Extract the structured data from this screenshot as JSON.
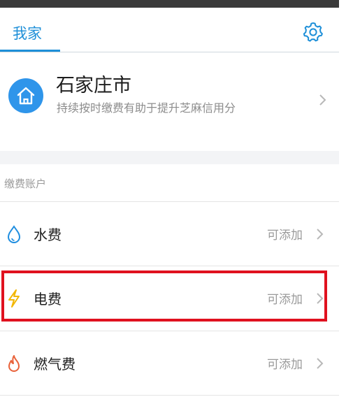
{
  "header": {
    "active_tab": "我家"
  },
  "home_card": {
    "city": "石家庄市",
    "subtitle": "持续按时缴费有助于提升芝麻信用分"
  },
  "accounts": {
    "section_label": "缴费账户",
    "items": [
      {
        "name": "水费",
        "status": "可添加",
        "icon": "water-drop-icon"
      },
      {
        "name": "电费",
        "status": "可添加",
        "icon": "lightning-icon"
      },
      {
        "name": "燃气费",
        "status": "可添加",
        "icon": "flame-icon"
      }
    ]
  },
  "colors": {
    "accent": "#1e8fd8",
    "highlight": "#e0111f",
    "water": "#1f8ee0",
    "electric": "#f2b705",
    "gas": "#e9623a"
  }
}
